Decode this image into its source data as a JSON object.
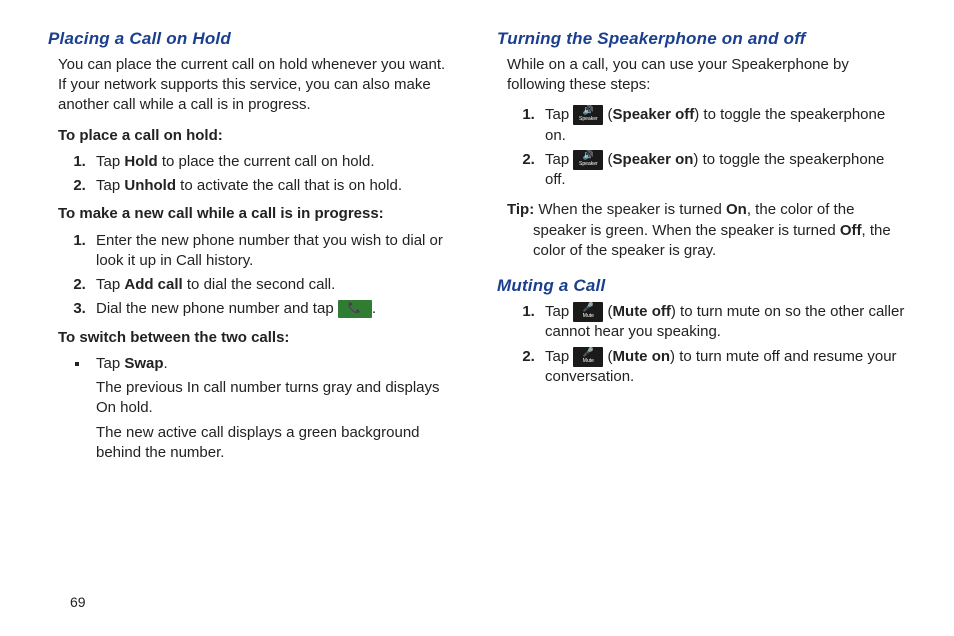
{
  "page_number": "69",
  "left": {
    "h1": "Placing a Call on Hold",
    "intro": "You can place the current call on hold whenever you want. If your network supports this service, you can also make another call while a call is in progress.",
    "sub1": "To place a call on hold:",
    "s1_1a": "Tap ",
    "s1_1b": "Hold",
    "s1_1c": " to place the current call on hold.",
    "s1_2a": "Tap ",
    "s1_2b": "Unhold",
    "s1_2c": " to activate the call that is on hold.",
    "sub2": "To make a new call while a call is in progress:",
    "s2_1": "Enter the new phone number that you wish to dial or look it up in Call history.",
    "s2_2a": "Tap ",
    "s2_2b": "Add call",
    "s2_2c": " to dial the second call.",
    "s2_3a": "Dial the new phone number and tap ",
    "s2_3b": ".",
    "sub3": "To switch between the two calls:",
    "s3_a": "Tap ",
    "s3_b": "Swap",
    "s3_c": ".",
    "s3_follow1": "The previous In call number turns gray and displays On hold.",
    "s3_follow2": "The new active call displays a green background behind the number."
  },
  "right": {
    "h1": "Turning the Speakerphone on and off",
    "intro": "While on a call, you can use your Speakerphone by following these steps:",
    "sp1_a": "Tap ",
    "sp1_b": " (",
    "sp1_c": "Speaker off",
    "sp1_d": ") to toggle the speakerphone on.",
    "sp2_a": "Tap ",
    "sp2_b": " (",
    "sp2_c": "Speaker on",
    "sp2_d": ") to toggle the speakerphone off.",
    "tip_label": "Tip:",
    "tip_a": " When the speaker is turned ",
    "tip_on": "On",
    "tip_b": ", the color of the speaker is green. When the speaker is turned ",
    "tip_off": "Off",
    "tip_c": ", the color of the speaker is gray.",
    "h2": "Muting a Call",
    "m1_a": "Tap ",
    "m1_b": " (",
    "m1_c": "Mute off",
    "m1_d": ") to turn mute on so the other caller cannot hear you speaking.",
    "m2_a": "Tap ",
    "m2_b": " (",
    "m2_c": "Mute on",
    "m2_d": ") to turn mute off and resume your conversation."
  }
}
